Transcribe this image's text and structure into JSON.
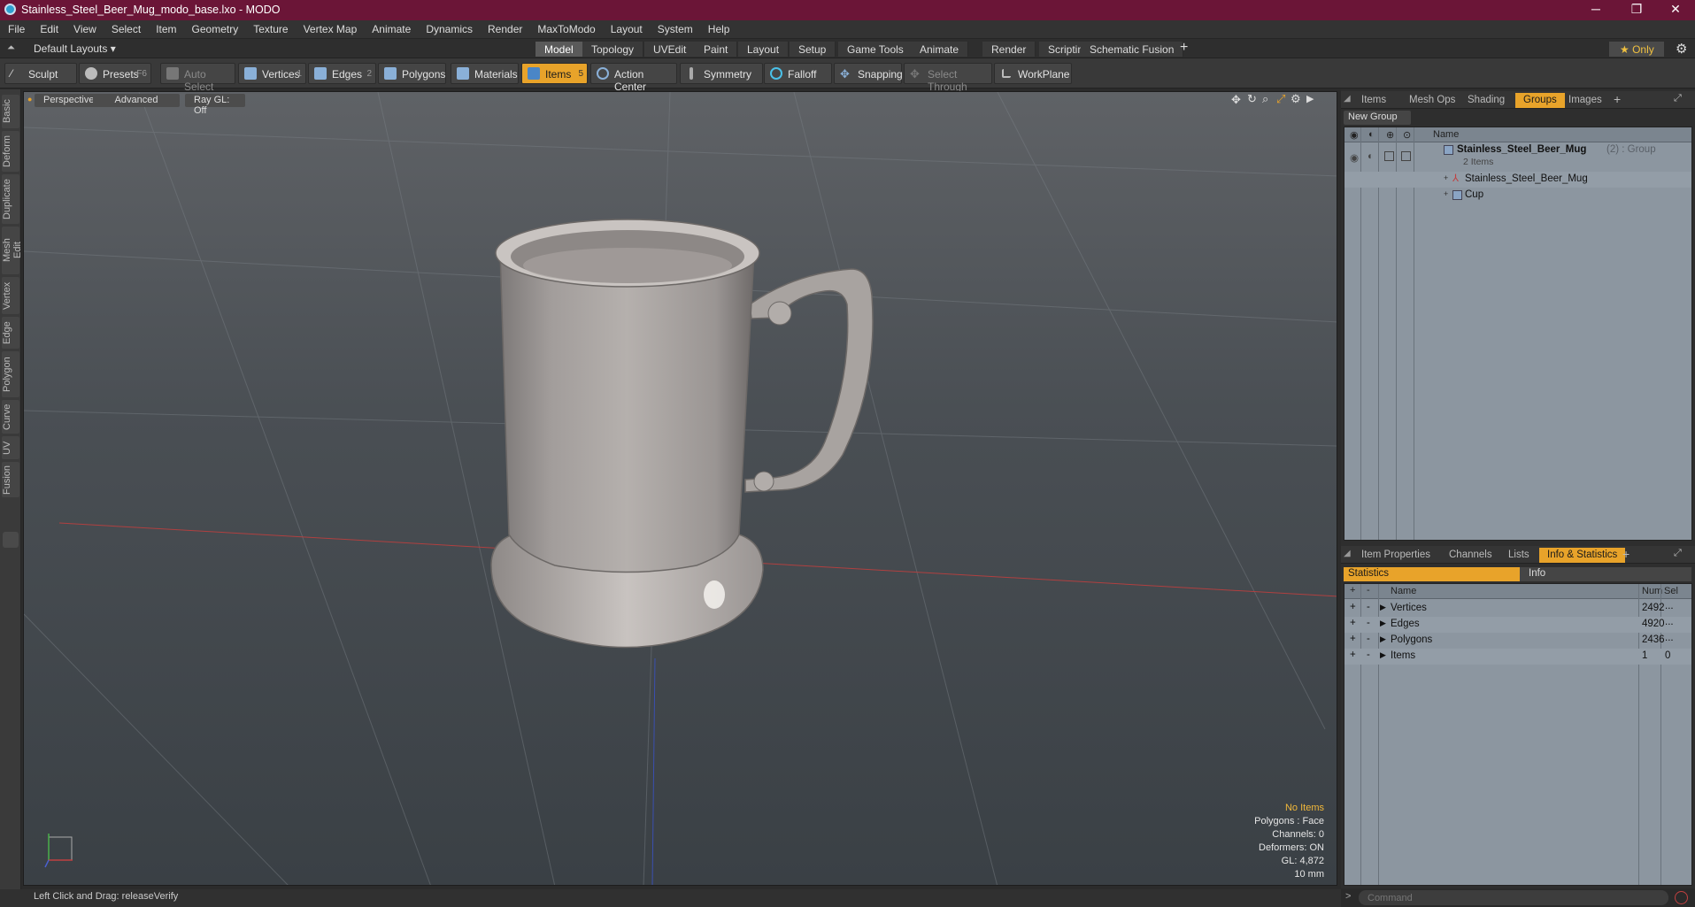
{
  "window": {
    "title": "Stainless_Steel_Beer_Mug_modo_base.lxo - MODO",
    "min": "─",
    "restore": "❐",
    "close": "✕"
  },
  "menu": [
    "File",
    "Edit",
    "View",
    "Select",
    "Item",
    "Geometry",
    "Texture",
    "Vertex Map",
    "Animate",
    "Dynamics",
    "Render",
    "MaxToModo",
    "Layout",
    "System",
    "Help"
  ],
  "layout_selector": "Default Layouts ▾",
  "layout_tabs": [
    "Model",
    "Topology",
    "UVEdit",
    "Paint",
    "Layout",
    "Setup",
    "Game Tools",
    "Animate",
    "Render",
    "Scripting",
    "Schematic Fusion"
  ],
  "layout_tab_add": "+",
  "only_label": "★  Only",
  "toolbar": {
    "sculpt": "Sculpt",
    "presets": "Presets",
    "presets_key": "F6",
    "auto_select": "Auto Select",
    "vertices": "Vertices",
    "vertices_key": "1",
    "edges": "Edges",
    "edges_key": "2",
    "polygons": "Polygons",
    "materials": "Materials",
    "items": "Items",
    "items_key": "5",
    "action_center": "Action Center",
    "symmetry": "Symmetry",
    "falloff": "Falloff",
    "snapping": "Snapping",
    "select_through": "Select Through",
    "workplane": "WorkPlane"
  },
  "left_tabs": [
    "Basic",
    "Deform",
    "Duplicate",
    "Mesh Edit",
    "Vertex",
    "Edge",
    "Polygon",
    "Curve",
    "UV",
    "Fusion"
  ],
  "viewport": {
    "view_mode": "Perspective",
    "shading": "Advanced",
    "raygl": "Ray GL: Off",
    "info": {
      "selection": "No Items",
      "polygons": "Polygons : Face",
      "channels": "Channels: 0",
      "deformers": "Deformers: ON",
      "gl": "GL: 4,872",
      "scale": "10 mm"
    }
  },
  "status": "Left Click and Drag:  releaseVerify",
  "groups_panel": {
    "tabs": [
      "Items",
      "Mesh Ops",
      "Shading",
      "Groups",
      "Images"
    ],
    "active_tab": "Groups",
    "new_group": "New Group",
    "name_header": "Name",
    "group_name": "Stainless_Steel_Beer_Mug",
    "group_suffix": "(2) : Group",
    "group_count": "2 Items",
    "children": [
      "Stainless_Steel_Beer_Mug",
      "Cup"
    ]
  },
  "info_panel": {
    "tabs": [
      "Item Properties",
      "Channels",
      "Lists",
      "Info & Statistics"
    ],
    "active_tab": "Info & Statistics",
    "sub_tabs": [
      "Statistics",
      "Info"
    ],
    "headers": {
      "name": "Name",
      "num": "Num",
      "sel": "Sel"
    },
    "rows": [
      {
        "name": "Vertices",
        "num": "2492",
        "sel": "..."
      },
      {
        "name": "Edges",
        "num": "4920",
        "sel": "..."
      },
      {
        "name": "Polygons",
        "num": "2436",
        "sel": "..."
      },
      {
        "name": "Items",
        "num": "1",
        "sel": "0"
      }
    ]
  },
  "command_placeholder": "Command"
}
